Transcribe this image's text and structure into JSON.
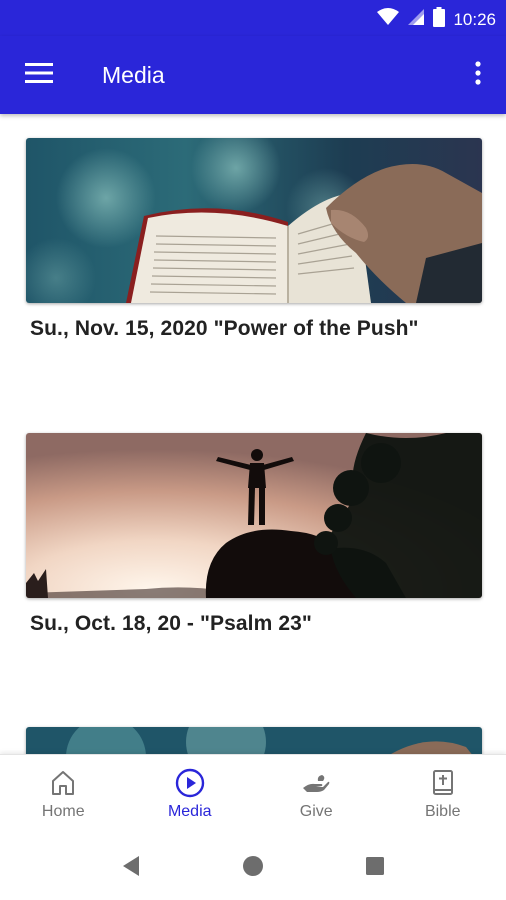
{
  "status_bar": {
    "time": "10:26"
  },
  "app_bar": {
    "title": "Media"
  },
  "cards": [
    {
      "title": "Su., Nov. 15, 2020 \"Power of the Push\""
    },
    {
      "title": "Su., Oct. 18, 20 - \"Psalm 23\""
    },
    {
      "title": ""
    }
  ],
  "bottom_nav": {
    "items": [
      {
        "label": "Home",
        "icon": "home-icon"
      },
      {
        "label": "Media",
        "icon": "play-circle-icon",
        "active": true
      },
      {
        "label": "Give",
        "icon": "give-hand-icon"
      },
      {
        "label": "Bible",
        "icon": "bible-icon"
      }
    ]
  },
  "colors": {
    "primary": "#2a26d9",
    "inactive": "#757575"
  }
}
